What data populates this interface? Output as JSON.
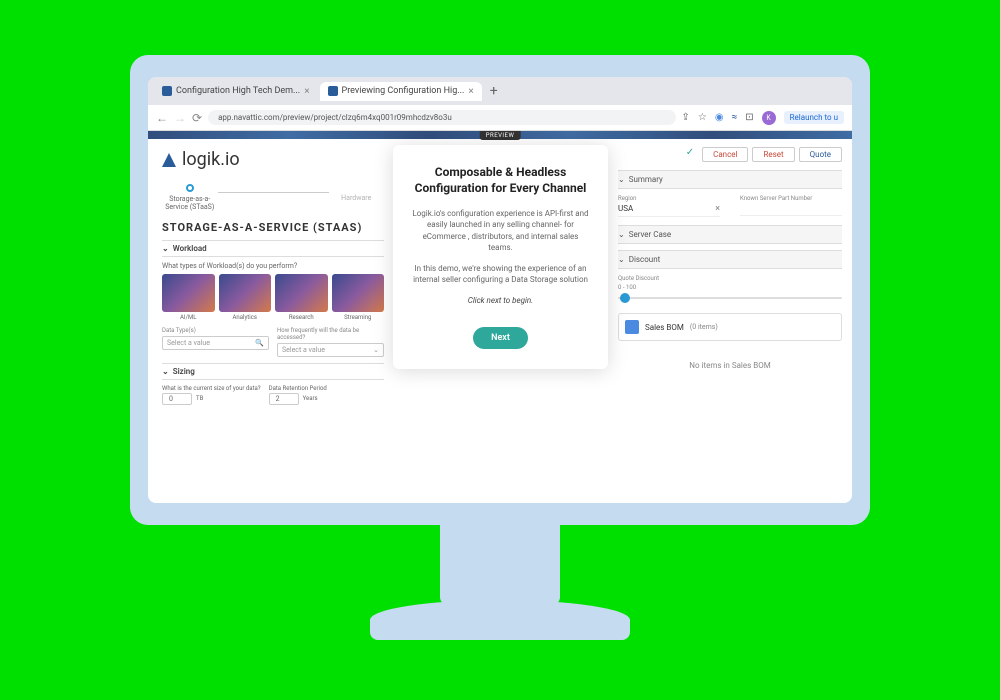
{
  "tabs": [
    {
      "label": "Configuration High Tech Dem...",
      "active": false
    },
    {
      "label": "Previewing Configuration Hig...",
      "active": true
    }
  ],
  "url": "app.navattic.com/preview/project/clzq6m4xq001r09mhcdzv8o3u",
  "relaunch": "Relaunch to u",
  "preview_badge": "PREVIEW",
  "logo": "logik.io",
  "step1": "Storage-as-a-Service (STaaS)",
  "step2": "Hardware",
  "title": "STORAGE-AS-A-SERVICE (STAAS)",
  "sec_workload": "Workload",
  "q_workload": "What types of Workload(s) do you perform?",
  "tiles": [
    "AI/ML",
    "Analytics",
    "Research",
    "Streaming"
  ],
  "field_datatype": "Data Type(s)",
  "field_freq": "How frequently will the data be accessed?",
  "select_ph": "Select a value",
  "sec_sizing": "Sizing",
  "q_size": "What is the current size of your data?",
  "q_retention": "Data Retention Period",
  "val_size": "0",
  "unit_size": "TB",
  "val_ret": "2",
  "unit_ret": "Years",
  "overlay": {
    "title": "Composable & Headless Configuration for Every Channel",
    "p1": "Logik.io's configuration experience is API-first and easily launched in any selling channel- for eCommerce , distributors, and internal sales teams.",
    "p2": "In this demo, we're showing the experience of an internal seller configuring a Data Storage solution",
    "cta": "Click next to begin.",
    "btn": "Next"
  },
  "actions": {
    "cancel": "Cancel",
    "reset": "Reset",
    "quote": "Quote"
  },
  "sec_summary": "Summary",
  "region_lbl": "Region",
  "region_val": "USA",
  "part_lbl": "Known Server Part Number",
  "sec_case": "Server Case",
  "sec_discount": "Discount",
  "discount_lbl": "Quote Discount",
  "discount_range": "0 - 100",
  "bom_title": "Sales BOM",
  "bom_count": "(0 items)",
  "bom_empty": "No items in Sales BOM"
}
